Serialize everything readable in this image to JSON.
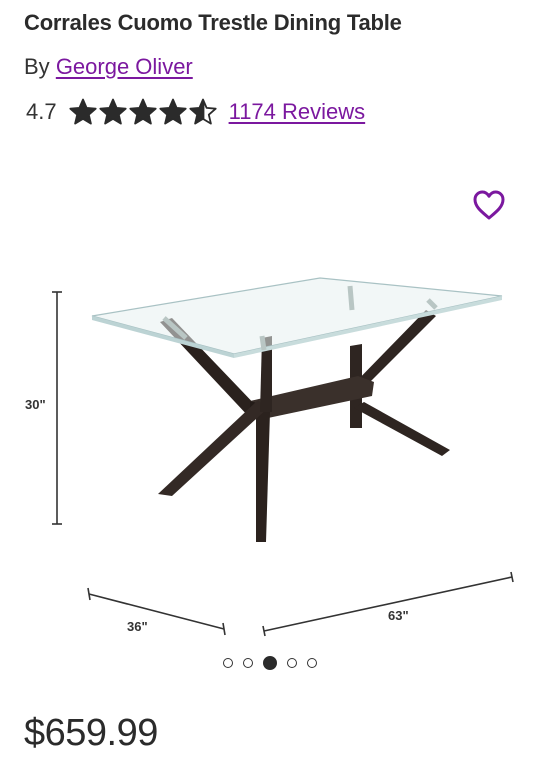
{
  "product": {
    "title": "Corrales Cuomo Trestle Dining Table",
    "by_prefix": "By",
    "brand": "George Oliver",
    "rating_value": "4.7",
    "rating_numeric": 4.7,
    "star_count": 5,
    "reviews_label": "1174 Reviews",
    "price": "$659.99"
  },
  "image": {
    "dimensions": {
      "height": "30\"",
      "depth": "36\"",
      "width": "63\""
    }
  },
  "carousel": {
    "count": 5,
    "active_index": 2
  },
  "icons": {
    "favorite": "heart-outline-icon",
    "star_full": "star-filled-icon",
    "star_partial": "star-half-icon"
  },
  "colors": {
    "accent": "#7b189f",
    "text": "#2b2b2b",
    "frame": "#2e2521"
  }
}
